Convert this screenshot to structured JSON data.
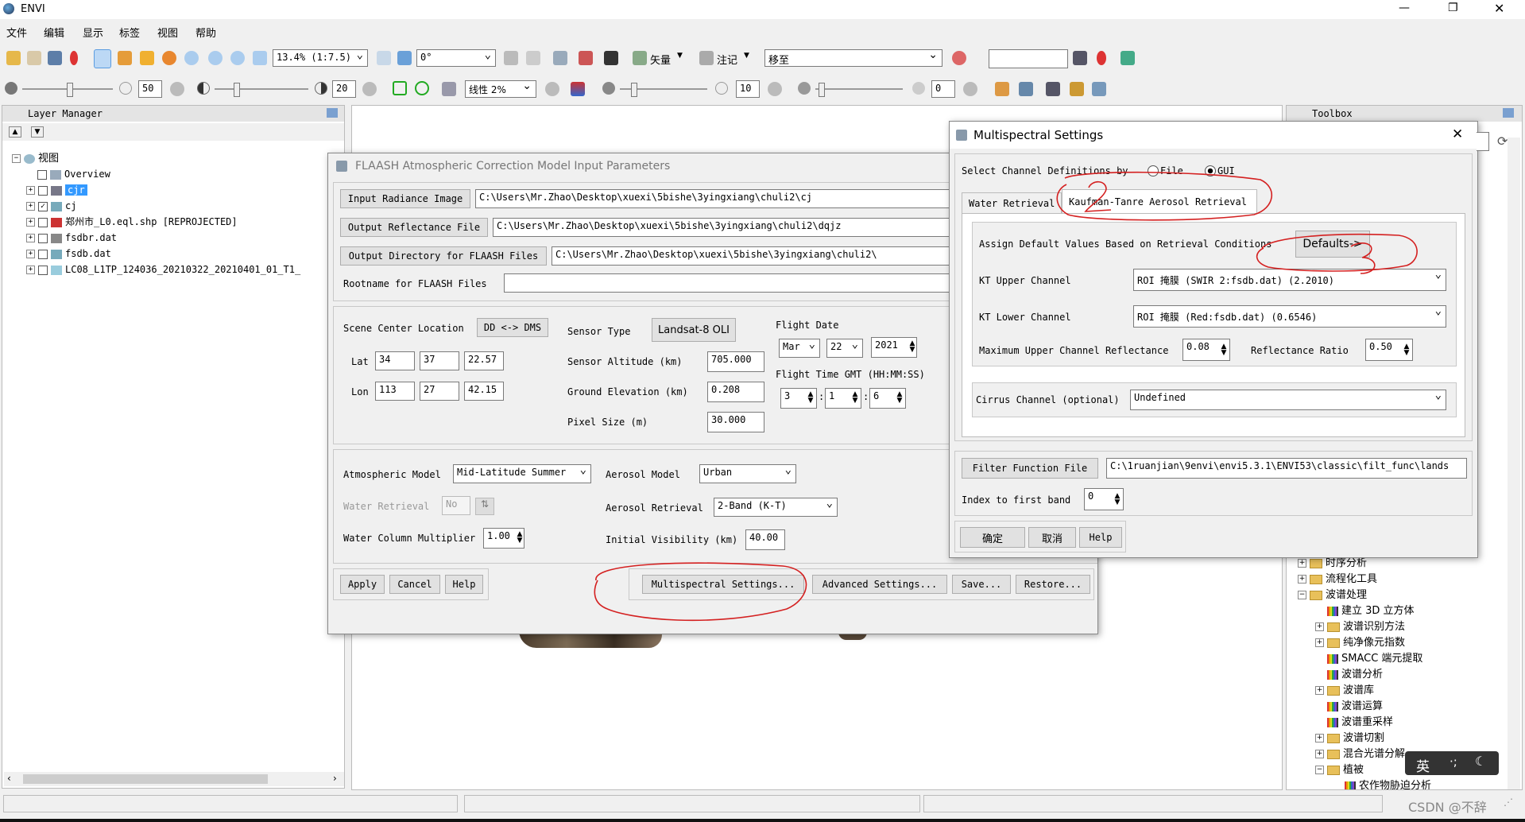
{
  "app": {
    "title": "ENVI",
    "icon": "envi-icon"
  },
  "menu": [
    "文件",
    "编辑",
    "显示",
    "标签",
    "视图",
    "帮助"
  ],
  "window_controls": [
    "minimize-icon",
    "maximize-icon",
    "close-icon"
  ],
  "toolbar1": {
    "zoom_value": "13.4% (1:7.5)",
    "rotation_value": "0°",
    "vector_label": "矢量",
    "annotation_label": "注记",
    "goto_value": "移至",
    "goto_input": ""
  },
  "toolbar2": {
    "brightness_value": "50",
    "contrast_value": "20",
    "stretch_value": "线性 2%",
    "sharpen_value": "10",
    "transparency_value": "0"
  },
  "layer_manager": {
    "title": "Layer Manager",
    "root": "视图",
    "items": [
      {
        "label": "Overview",
        "checked": false,
        "selected": false
      },
      {
        "label": "cjr",
        "checked": false,
        "selected": true
      },
      {
        "label": "cj",
        "checked": true,
        "selected": false
      },
      {
        "label": "郑州市_L0.eql.shp [REPROJECTED]",
        "checked": false,
        "selected": false
      },
      {
        "label": "fsdbr.dat",
        "checked": false,
        "selected": false
      },
      {
        "label": "fsdb.dat",
        "checked": false,
        "selected": false
      },
      {
        "label": "LC08_L1TP_124036_20210322_20210401_01_T1_",
        "checked": false,
        "selected": false
      }
    ]
  },
  "toolbox": {
    "title": "Toolbox",
    "items": [
      {
        "label": "时序分析",
        "kind": "folder",
        "level": 0,
        "expander": "+"
      },
      {
        "label": "流程化工具",
        "kind": "folder",
        "level": 0,
        "expander": "+"
      },
      {
        "label": "波谱处理",
        "kind": "folder",
        "level": 0,
        "expander": "-"
      },
      {
        "label": "建立 3D 立方体",
        "kind": "tool",
        "level": 1,
        "expander": ""
      },
      {
        "label": "波谱识别方法",
        "kind": "folder",
        "level": 1,
        "expander": "+"
      },
      {
        "label": "纯净像元指数",
        "kind": "folder",
        "level": 1,
        "expander": "+"
      },
      {
        "label": "SMACC 端元提取",
        "kind": "tool",
        "level": 1,
        "expander": ""
      },
      {
        "label": "波谱分析",
        "kind": "tool",
        "level": 1,
        "expander": ""
      },
      {
        "label": "波谱库",
        "kind": "folder",
        "level": 1,
        "expander": "+"
      },
      {
        "label": "波谱运算",
        "kind": "tool",
        "level": 1,
        "expander": ""
      },
      {
        "label": "波谱重采样",
        "kind": "tool",
        "level": 1,
        "expander": ""
      },
      {
        "label": "波谱切割",
        "kind": "folder",
        "level": 1,
        "expander": "+"
      },
      {
        "label": "混合光谱分解",
        "kind": "folder",
        "level": 1,
        "expander": "+"
      },
      {
        "label": "植被",
        "kind": "folder",
        "level": 1,
        "expander": "-"
      },
      {
        "label": "农作物胁迫分析",
        "kind": "tool",
        "level": 2,
        "expander": ""
      }
    ]
  },
  "ime": {
    "label": "英"
  },
  "watermark": "CSDN @不辞",
  "flaash": {
    "title": "FLAASH Atmospheric Correction Model Input Parameters",
    "input_radiance_label": "Input Radiance Image",
    "input_radiance_value": "C:\\Users\\Mr.Zhao\\Desktop\\xuexi\\5bishe\\3yingxiang\\chuli2\\cj",
    "output_reflectance_label": "Output Reflectance File",
    "output_reflectance_value": "C:\\Users\\Mr.Zhao\\Desktop\\xuexi\\5bishe\\3yingxiang\\chuli2\\dqjz",
    "output_dir_label": "Output Directory for FLAASH Files",
    "output_dir_value": "C:\\Users\\Mr.Zhao\\Desktop\\xuexi\\5bishe\\3yingxiang\\chuli2\\",
    "rootname_label": "Rootname for FLAASH Files",
    "rootname_value": "",
    "scene_center_label": "Scene Center Location",
    "dd_dms_label": "DD <-> DMS",
    "lat_label": "Lat",
    "lat": [
      "34",
      "37",
      "22.57"
    ],
    "lon_label": "Lon",
    "lon": [
      "113",
      "27",
      "42.15"
    ],
    "sensor_type_label": "Sensor Type",
    "sensor_type_value": "Landsat-8 OLI",
    "sensor_altitude_label": "Sensor Altitude (km)",
    "sensor_altitude_value": "705.000",
    "ground_elevation_label": "Ground Elevation (km)",
    "ground_elevation_value": "0.208",
    "pixel_size_label": "Pixel Size (m)",
    "pixel_size_value": "30.000",
    "flight_date_label": "Flight Date",
    "flight_month": "Mar",
    "flight_day": "22",
    "flight_year": "2021",
    "flight_time_label": "Flight Time GMT (HH:MM:SS)",
    "flight_time": [
      "3",
      "1",
      "6"
    ],
    "atm_model_label": "Atmospheric Model",
    "atm_model_value": "Mid-Latitude Summer",
    "aerosol_model_label": "Aerosol Model",
    "aerosol_model_value": "Urban",
    "water_retrieval_label": "Water Retrieval",
    "water_retrieval_value": "No",
    "aerosol_retrieval_label": "Aerosol Retrieval",
    "aerosol_retrieval_value": "2-Band (K-T)",
    "water_column_label": "Water Column Multiplier",
    "water_column_value": "1.00",
    "initial_visibility_label": "Initial Visibility (km)",
    "initial_visibility_value": "40.00",
    "apply": "Apply",
    "cancel": "Cancel",
    "help": "Help",
    "multispectral": "Multispectral Settings...",
    "advanced": "Advanced Settings...",
    "save": "Save...",
    "restore": "Restore..."
  },
  "multispectral": {
    "title": "Multispectral Settings",
    "select_by_label": "Select Channel Definitions by",
    "opt_file": "File",
    "opt_gui": "GUI",
    "selected_option": "GUI",
    "tab_water": "Water Retrieval",
    "tab_kt": "Kaufman-Tanre Aerosol Retrieval",
    "assign_defaults_label": "Assign Default Values Based on Retrieval Conditions",
    "defaults_button": "Defaults->",
    "kt_upper_label": "KT Upper Channel",
    "kt_upper_value": "ROI 掩膜 (SWIR 2:fsdb.dat) (2.2010)",
    "kt_lower_label": "KT Lower Channel",
    "kt_lower_value": "ROI 掩膜 (Red:fsdb.dat) (0.6546)",
    "max_upper_label": "Maximum Upper Channel Reflectance",
    "max_upper_value": "0.08",
    "reflectance_ratio_label": "Reflectance Ratio",
    "reflectance_ratio_value": "0.50",
    "cirrus_label": "Cirrus Channel (optional)",
    "cirrus_value": "Undefined",
    "filter_function_label": "Filter Function File",
    "filter_function_value": "C:\\1ruanjian\\9envi\\envi5.3.1\\ENVI53\\classic\\filt_func\\lands",
    "index_first_band_label": "Index to first band",
    "index_first_band_value": "0",
    "ok": "确定",
    "cancel": "取消",
    "help": "Help"
  },
  "colors": {
    "annotation_red": "#d42020",
    "selection_blue": "#3399ff"
  }
}
